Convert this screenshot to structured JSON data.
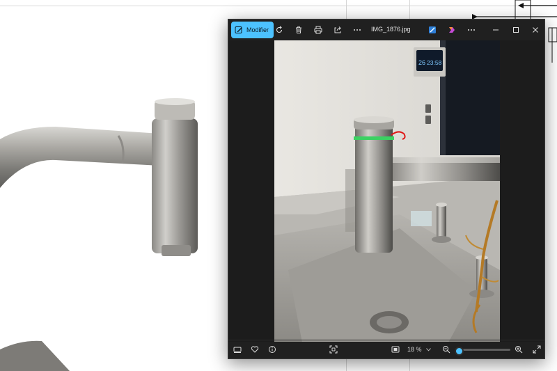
{
  "window": {
    "file_name": "IMG_1876.jpg",
    "edit_button_label": "Modifier",
    "accent_color": "#4cc2ff"
  },
  "toolbar": {
    "icons": [
      "edit-icon",
      "rotate-icon",
      "delete-icon",
      "print-icon",
      "share-icon",
      "more-icon"
    ],
    "right_icons": [
      "draw-icon",
      "copilot-icon",
      "more-icon"
    ]
  },
  "window_controls": [
    "minimize-icon",
    "maximize-icon",
    "close-icon"
  ],
  "photo": {
    "clock_day": "26",
    "clock_time": "23:58"
  },
  "bottom_bar": {
    "zoom_label": "18 %",
    "zoom_level": 0.02,
    "icons": [
      "filmstrip-icon",
      "favorite-icon",
      "info-icon",
      "fit-icon",
      "actual-size-icon",
      "zoom-out-icon",
      "zoom-in-icon",
      "fullscreen-icon"
    ]
  }
}
